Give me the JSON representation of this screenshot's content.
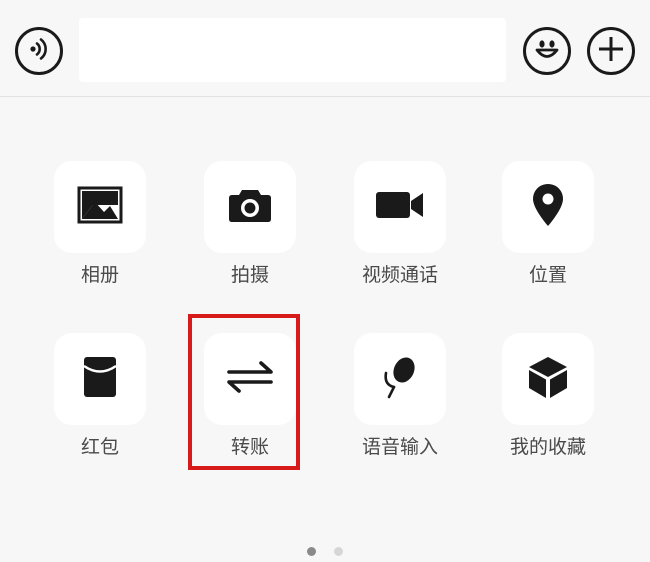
{
  "input_bar": {
    "voice_icon": "voice-wave-icon",
    "emoji_icon": "smiley-face-icon",
    "plus_icon": "plus-icon",
    "text_value": "",
    "text_placeholder": ""
  },
  "panel": {
    "items": [
      {
        "label": "相册",
        "icon": "image-icon"
      },
      {
        "label": "拍摄",
        "icon": "camera-icon"
      },
      {
        "label": "视频通话",
        "icon": "video-camera-icon"
      },
      {
        "label": "位置",
        "icon": "location-pin-icon"
      },
      {
        "label": "红包",
        "icon": "red-envelope-icon"
      },
      {
        "label": "转账",
        "icon": "transfer-arrows-icon"
      },
      {
        "label": "语音输入",
        "icon": "microphone-icon"
      },
      {
        "label": "我的收藏",
        "icon": "cube-icon"
      }
    ],
    "highlighted_item": "转账",
    "highlight_color": "#d71a1a",
    "page_count": 2,
    "current_page": 1
  }
}
